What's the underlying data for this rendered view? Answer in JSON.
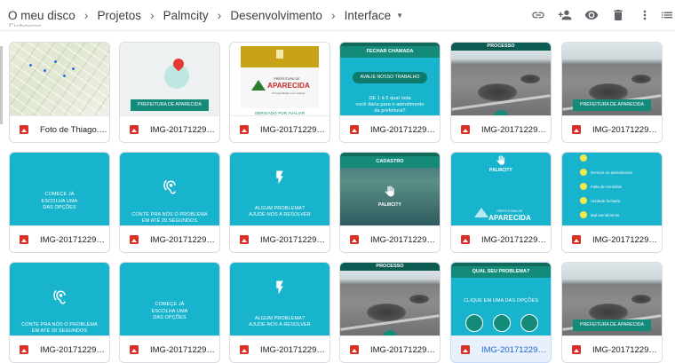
{
  "breadcrumb": {
    "items": [
      "O meu disco",
      "Projetos",
      "Palmcity",
      "Desenvolvimento"
    ],
    "current": "Interface"
  },
  "toolbar": {
    "icons": [
      "link-icon",
      "add-person-icon",
      "eye-icon",
      "trash-icon",
      "more-vert-icon",
      "list-view-icon"
    ]
  },
  "section_label": "Ficheiros",
  "files": [
    {
      "name": "Foto de Thiago. A...",
      "thumb": "map"
    },
    {
      "name": "IMG-20171229-W...",
      "thumb": "pin",
      "banner": "PREFEITURA DE APARECIDA"
    },
    {
      "name": "IMG-20171229-W...",
      "thumb": "logo",
      "logo_small": "PREFEITURA DE",
      "logo_big": "APARECIDA",
      "logo_sub": "Prosperidade com Justiça",
      "note": "OBRIGADO POR AVALIAR"
    },
    {
      "name": "IMG-20171229-W...",
      "thumb": "rate",
      "header": "FECHAR CHAMADA",
      "button": "AVALIE NOSSO TRABALHO",
      "line1": "DE 1 à 5 qual nota",
      "line2": "você daria para o atendimento",
      "line3": "da prefeitura?"
    },
    {
      "name": "IMG-20171229-W...",
      "thumb": "road",
      "header": "PROCESSO"
    },
    {
      "name": "IMG-20171229-W...",
      "thumb": "road",
      "banner": "PREFEITURA DE APARECIDA"
    },
    {
      "name": "IMG-20171229-W...",
      "thumb": "teal",
      "line1": "COMEÇE JÁ",
      "line2": "ESCOLHA UMA",
      "line3": "DAS OPÇÕES"
    },
    {
      "name": "IMG-20171229-W...",
      "thumb": "ear",
      "line1": "CONTE PRA NÓS O PROBLEMA",
      "line2": "EM ATÉ 20 SEGUNDOS"
    },
    {
      "name": "IMG-20171229-W...",
      "thumb": "bolt",
      "line1": "ALGUM PROBLEMA?",
      "line2": "AJUDE-NOS A RESOLVER"
    },
    {
      "name": "IMG-20171229-W...",
      "thumb": "cadastro",
      "header": "CADASTRO",
      "brand": "PALMCITY"
    },
    {
      "name": "IMG-20171229-W...",
      "thumb": "palm",
      "brand": "PALMCITY",
      "logo_small": "PREFEITURA DE",
      "logo_big": "APARECIDA"
    },
    {
      "name": "IMG-20171229-W...",
      "thumb": "options",
      "items": [
        "Demora no atendimento",
        "Falta de remédios",
        "Unidade fechada",
        "Mal atendimento"
      ]
    },
    {
      "name": "IMG-20171229-W...",
      "thumb": "ear",
      "line1": "CONTE PRA NÓS O PROBLEMA",
      "line2": "EM ATÉ 20 SEGUNDOS"
    },
    {
      "name": "IMG-20171229-W...",
      "thumb": "teal",
      "line1": "COMEÇE JÁ",
      "line2": "ESCOLHA UMA",
      "line3": "DAS OPÇÕES"
    },
    {
      "name": "IMG-20171229-W...",
      "thumb": "bolt",
      "line1": "ALGUM PROBLEMA?",
      "line2": "AJUDE-NOS A RESOLVER"
    },
    {
      "name": "IMG-20171229-W...",
      "thumb": "road",
      "header": "PROCESSO"
    },
    {
      "name": "IMG-20171229-W...",
      "thumb": "problem",
      "header": "QUAL SEU PROBLEMA?",
      "line1": "CLIQUE EM UMA DAS OPÇÕES",
      "selected": true
    },
    {
      "name": "IMG-20171229-W...",
      "thumb": "road",
      "banner": "PREFEITURA DE APARECIDA"
    }
  ],
  "colors": {
    "teal": "#18b3cc",
    "green": "#138b78",
    "selected": "#1967d2",
    "file_icon": "#d93025"
  }
}
